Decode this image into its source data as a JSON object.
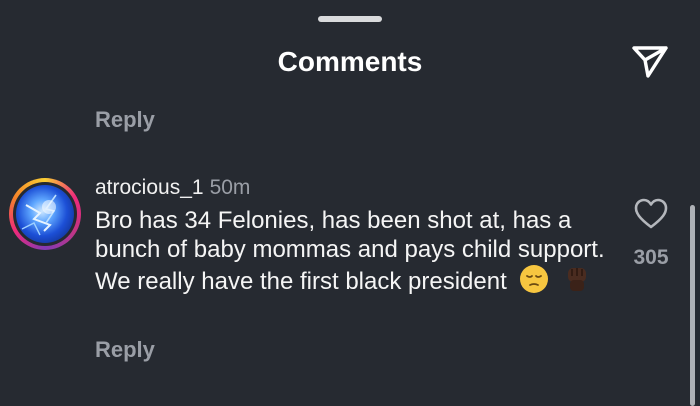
{
  "header": {
    "title": "Comments",
    "send_icon": "send-icon"
  },
  "replies": {
    "top_label": "Reply",
    "bottom_label": "Reply"
  },
  "comment": {
    "username": "atrocious_1",
    "time": "50m",
    "text": "Bro has 34 Felonies, has been shot at, has a bunch of baby mommas and pays child support. We really have the first black president",
    "emoji": [
      "pensive-face-emoji",
      "raised-fist-dark-skin-emoji"
    ],
    "likes": "305",
    "like_icon": "heart-icon"
  },
  "colors": {
    "background": "#262a31",
    "text": "#f5f5f5",
    "secondary": "#9a9ea6"
  }
}
